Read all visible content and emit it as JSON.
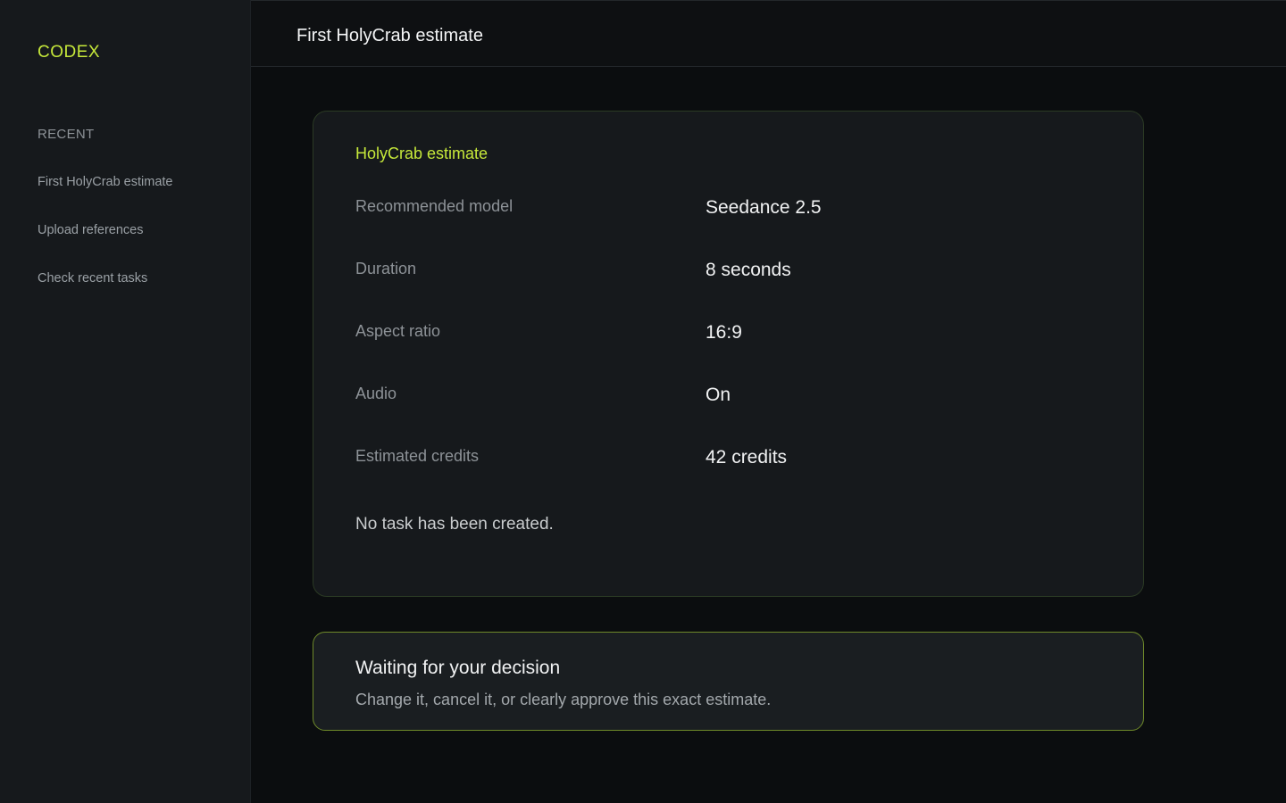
{
  "sidebar": {
    "brand": "CODEX",
    "section_label": "RECENT",
    "items": [
      {
        "label": "First HolyCrab estimate"
      },
      {
        "label": "Upload references"
      },
      {
        "label": "Check recent tasks"
      }
    ]
  },
  "header": {
    "title": "First HolyCrab estimate"
  },
  "estimate": {
    "title": "HolyCrab estimate",
    "rows": [
      {
        "label": "Recommended model",
        "value": "Seedance 2.5"
      },
      {
        "label": "Duration",
        "value": "8 seconds"
      },
      {
        "label": "Aspect ratio",
        "value": "16:9"
      },
      {
        "label": "Audio",
        "value": "On"
      },
      {
        "label": "Estimated credits",
        "value": "42 credits"
      }
    ],
    "note": "No task has been created."
  },
  "decision": {
    "title": "Waiting for your decision",
    "text": "Change it, cancel it, or clearly approve this exact estimate."
  },
  "colors": {
    "accent": "#c6e83a",
    "background": "#0b0d0f",
    "sidebar": "#16191c",
    "card": "#16191c",
    "decision_border": "#6f8a2a"
  }
}
